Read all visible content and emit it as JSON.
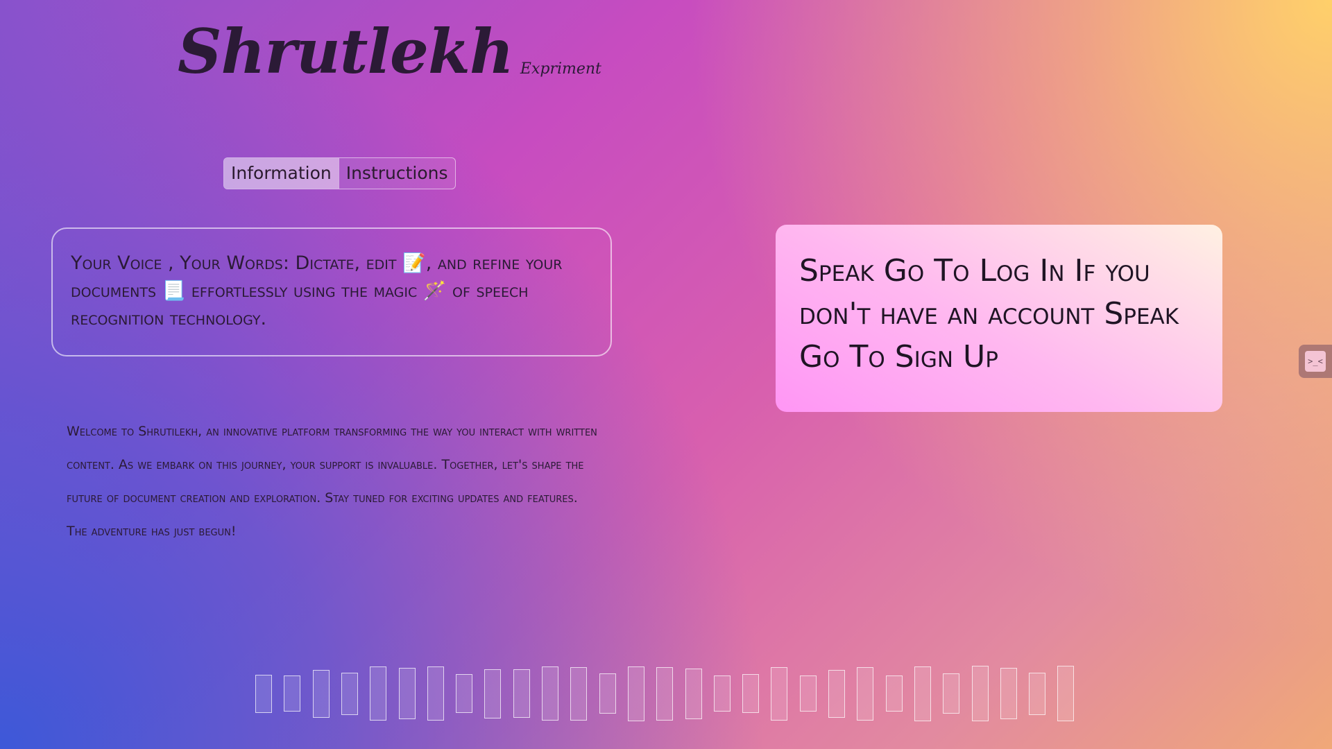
{
  "brand": {
    "title": "Shrutlekh",
    "subtitle": "Expriment"
  },
  "tabs": [
    {
      "label": "Information",
      "active": true
    },
    {
      "label": "Instructions",
      "active": false
    }
  ],
  "info_card": {
    "part1": "Your Voice , Your Words: Dictate, edit ",
    "icon1": "📝",
    "part2": ", and refine your documents ",
    "icon2": "📃",
    "part3": " effortlessly using the magic ",
    "icon3": "🪄",
    "part4": " of speech recognition technology."
  },
  "welcome_text": "Welcome to Shrutilekh, an innovative platform transforming the way you interact with written content. As we embark on this journey, your support is invaluable. Together, let's shape the future of document creation and exploration. Stay tuned for exciting updates and features. The adventure has just begun!",
  "voice_card": {
    "text": "Speak Go To Log In If you don't have an account Speak Go To Sign Up"
  },
  "side_handle": {
    "icon": "face-icon",
    "glyph": ">_<"
  },
  "visualizer": {
    "levels": [
      0.5,
      0.45,
      0.78,
      0.62,
      0.95,
      0.88,
      0.97,
      0.52,
      0.82,
      0.8,
      0.97,
      0.94,
      0.55,
      0.98,
      0.94,
      0.86,
      0.45,
      0.52,
      0.94,
      0.45,
      0.78,
      0.94,
      0.45,
      0.98,
      0.55,
      1.0,
      0.88,
      0.62,
      1.0
    ]
  },
  "colors": {
    "accent": "#c74cc0",
    "card_pink": "#ff96f5",
    "text_dark": "#2b1a36"
  }
}
